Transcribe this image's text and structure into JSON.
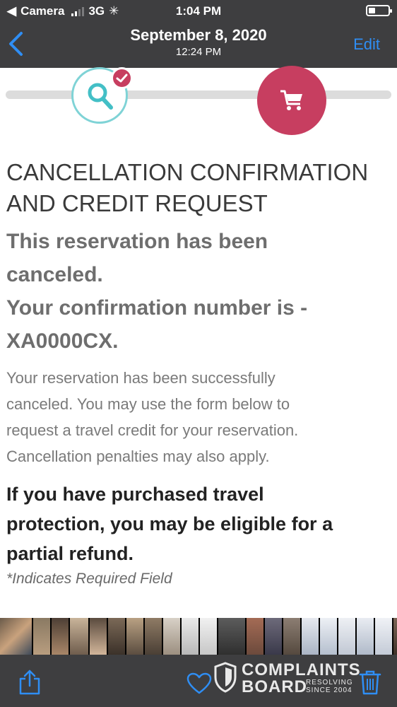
{
  "status_bar": {
    "carrier": "Camera",
    "network": "3G",
    "time": "1:04 PM"
  },
  "nav": {
    "title": "September 8, 2020",
    "subtitle": "12:24 PM",
    "edit_label": "Edit"
  },
  "progress": {
    "steps": [
      {
        "icon": "search-icon",
        "state": "complete"
      },
      {
        "icon": "cart-icon",
        "state": "current"
      }
    ],
    "accent": "#c73e60",
    "teal": "#7fd3d6"
  },
  "page": {
    "heading_line1": "CANCELLATION CONFIRMATION",
    "heading_line2": "AND CREDIT REQUEST",
    "status_line1": "This reservation has been",
    "status_line2": "canceled.",
    "status_line3": "Your confirmation number is -",
    "confirmation_number": "XA0000CX.",
    "desc_line1": "Your reservation has been successfully",
    "desc_line2": "canceled. You may use the form below to",
    "desc_line3": "request a travel credit for your reservation.",
    "desc_line4": "Cancellation penalties may also apply.",
    "protection_line1": "If you have purchased travel",
    "protection_line2": "protection, you may be eligible for a",
    "protection_line3": "partial refund.",
    "required_note": "*Indicates Required Field"
  },
  "watermark": {
    "line1": "COMPLAINTS",
    "line2": "BOARD",
    "tag1": "RESOLVING",
    "tag2": "SINCE 2004"
  },
  "toolbar": {
    "share": "share-icon",
    "favorite": "heart-icon",
    "delete": "trash-icon"
  }
}
